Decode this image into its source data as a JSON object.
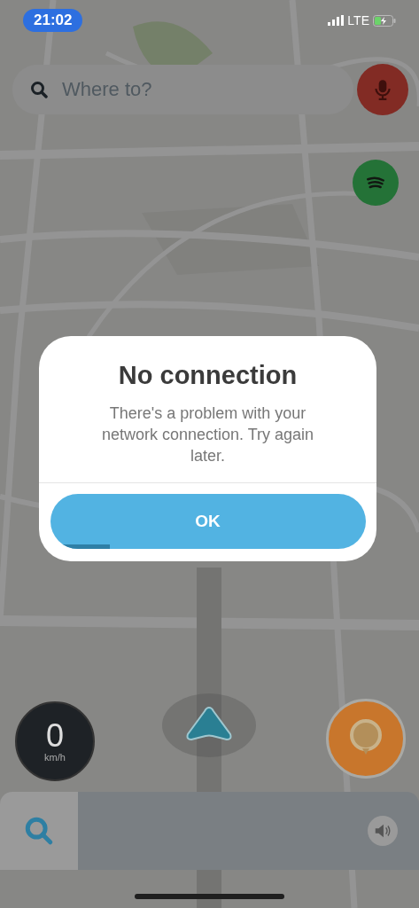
{
  "status_bar": {
    "time": "21:02",
    "network": "LTE"
  },
  "search": {
    "placeholder": "Where to?"
  },
  "dialog": {
    "title": "No connection",
    "message": "There's a problem with your network connection. Try again later.",
    "button": {
      "label": "OK",
      "level": 0.19
    }
  },
  "speedometer": {
    "speed": "0",
    "unit": "km/h"
  }
}
